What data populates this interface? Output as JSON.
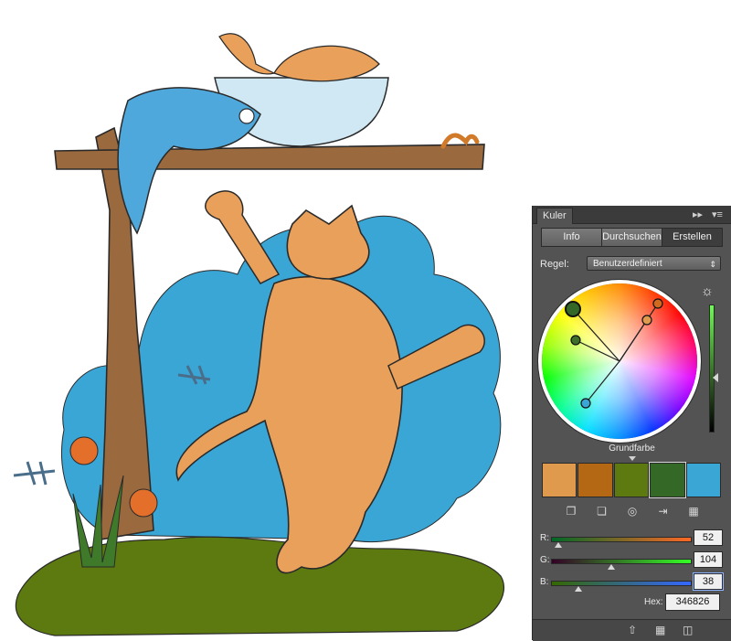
{
  "panel": {
    "tab_label": "Kuler",
    "tabs": [
      {
        "label": "Info",
        "active": false
      },
      {
        "label": "Durchsuchen",
        "active": false
      },
      {
        "label": "Erstellen",
        "active": true
      }
    ],
    "rule_label": "Regel:",
    "rule_value": "Benutzerdefiniert",
    "base_color_label": "Grundfarbe",
    "swatch_colors": [
      "#E09A4E",
      "#B56814",
      "#5C7A10",
      "#346826",
      "#3AA6D6"
    ],
    "selected_swatch": 3,
    "rgb": {
      "r_label": "R:",
      "r_value": "52",
      "g_label": "G:",
      "g_value": "104",
      "b_label": "B:",
      "b_value": "38"
    },
    "hex_label": "Hex:",
    "hex_value": "346826",
    "brightness_level": 0.55
  },
  "icons": {
    "expand": "double-chevron-right-icon",
    "menu": "panel-menu-icon",
    "sun": "brightness-icon"
  },
  "colors": {
    "sky_blue": "#3AA6D6",
    "cat_orange": "#E8A05A",
    "grass_green": "#5C7A10",
    "branch_brown": "#9A6A3E",
    "fish_blue": "#4FA8DC"
  }
}
